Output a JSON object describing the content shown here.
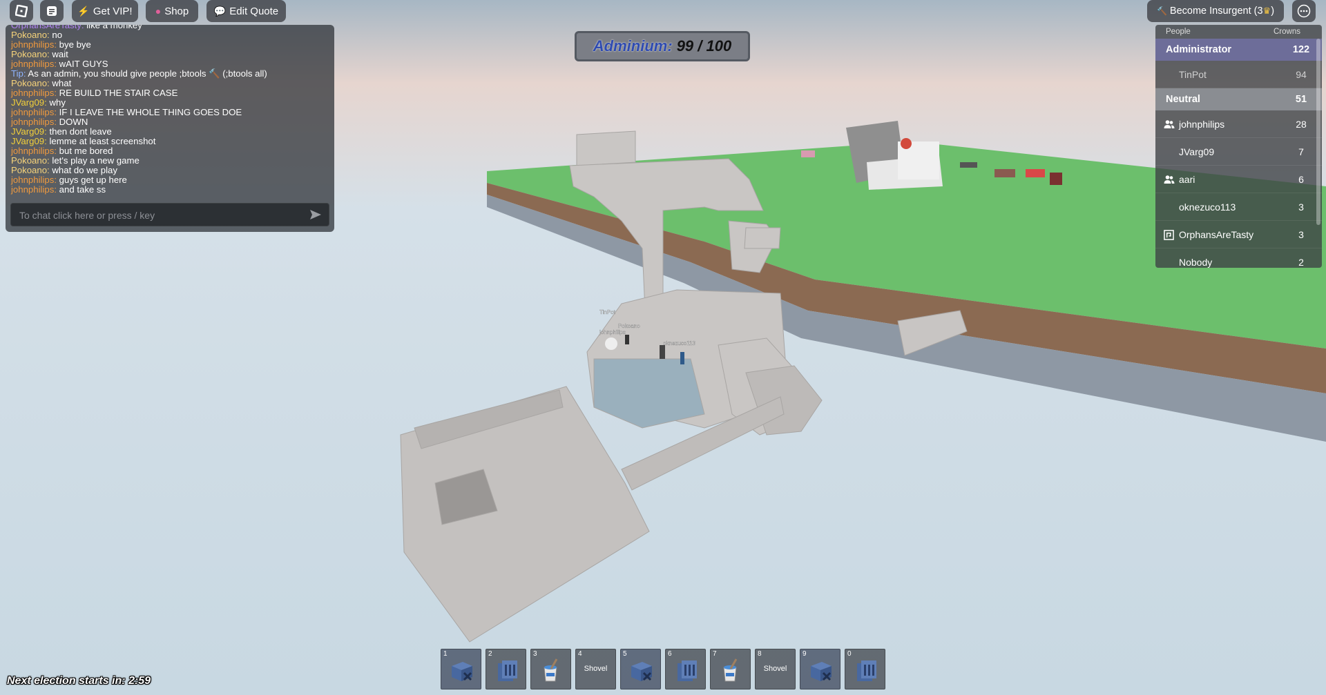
{
  "top_bar": {
    "roblox_icon": "roblox-logo-icon",
    "chat_icon": "chat-icon",
    "vip_label": "Get VIP!",
    "shop_label": "Shop",
    "quote_label": "Edit Quote",
    "insurgent_label": "Become Insurgent (3",
    "insurgent_suffix": ")",
    "menu_icon": "more-menu-icon"
  },
  "chat": {
    "messages": [
      {
        "user": "OrphansAreTasty:",
        "text": " like a monkey",
        "color": "#b183f2"
      },
      {
        "user": "Pokoano:",
        "text": " no",
        "color": "#f6d37a"
      },
      {
        "user": "johnphilips:",
        "text": " bye bye",
        "color": "#f09a3e"
      },
      {
        "user": "Pokoano:",
        "text": " wait",
        "color": "#f6d37a"
      },
      {
        "user": "johnphilips:",
        "text": " wAIT GUYS",
        "color": "#f09a3e"
      },
      {
        "user": "Tip:",
        "text": " As an admin, you should give people ;btools 🔨 (;btools all)",
        "color": "#8fb4ff"
      },
      {
        "user": "Pokoano:",
        "text": " what",
        "color": "#f6d37a"
      },
      {
        "user": "johnphilips:",
        "text": " RE BUILD THE STAIR CASE",
        "color": "#f09a3e"
      },
      {
        "user": "JVarg09:",
        "text": " why",
        "color": "#f2cf3a"
      },
      {
        "user": "johnphilips:",
        "text": " IF I LEAVE THE WHOLE THING GOES DOE",
        "color": "#f09a3e"
      },
      {
        "user": "johnphilips:",
        "text": " DOWN",
        "color": "#f09a3e"
      },
      {
        "user": "JVarg09:",
        "text": " then dont leave",
        "color": "#f2cf3a"
      },
      {
        "user": "JVarg09:",
        "text": " lemme at least screenshot",
        "color": "#f2cf3a"
      },
      {
        "user": "johnphilips:",
        "text": " but me bored",
        "color": "#f09a3e"
      },
      {
        "user": "Pokoano:",
        "text": " let's play a new game",
        "color": "#f6d37a"
      },
      {
        "user": "Pokoano:",
        "text": " what do we play",
        "color": "#f6d37a"
      },
      {
        "user": "johnphilips:",
        "text": " guys get up here",
        "color": "#f09a3e"
      },
      {
        "user": "johnphilips:",
        "text": " and take ss",
        "color": "#f09a3e"
      }
    ],
    "input_placeholder": "To chat click here or press / key",
    "send_icon": "send-arrow-icon"
  },
  "adminium": {
    "label": "Adminium:",
    "value": "99 / 100"
  },
  "leaderboard": {
    "header_people": "People",
    "header_crowns": "Crowns",
    "teams": [
      {
        "name": "Administrator",
        "score": "122",
        "color": "#6d6d99",
        "players": [
          {
            "name": "TinPot",
            "score": "94",
            "icon": "none",
            "dim": true
          }
        ]
      },
      {
        "name": "Neutral",
        "score": "51",
        "color": "#8a8d92",
        "players": [
          {
            "name": "johnphilips",
            "score": "28",
            "icon": "friends-icon",
            "dim": false
          },
          {
            "name": "JVarg09",
            "score": "7",
            "icon": "none",
            "dim": false
          },
          {
            "name": "aari",
            "score": "6",
            "icon": "friends-icon",
            "dim": false
          },
          {
            "name": "oknezuco113",
            "score": "3",
            "icon": "none",
            "dim": false
          },
          {
            "name": "OrphansAreTasty",
            "score": "3",
            "icon": "premium-icon",
            "dim": false
          },
          {
            "name": "Nobody",
            "score": "2",
            "icon": "none",
            "dim": false
          }
        ]
      }
    ]
  },
  "hotbar": {
    "slots": [
      {
        "num": "1",
        "label": "",
        "icon": "build-tools-icon",
        "active": true
      },
      {
        "num": "2",
        "label": "",
        "icon": "delete-tool-icon",
        "active": false
      },
      {
        "num": "3",
        "label": "",
        "icon": "paint-bucket-icon",
        "active": false
      },
      {
        "num": "4",
        "label": "Shovel",
        "icon": "none",
        "active": false
      },
      {
        "num": "5",
        "label": "",
        "icon": "build-tools-icon",
        "active": true
      },
      {
        "num": "6",
        "label": "",
        "icon": "delete-tool-icon",
        "active": false
      },
      {
        "num": "7",
        "label": "",
        "icon": "paint-bucket-icon",
        "active": false
      },
      {
        "num": "8",
        "label": "Shovel",
        "icon": "none",
        "active": false
      },
      {
        "num": "9",
        "label": "",
        "icon": "build-tools-icon",
        "active": true
      },
      {
        "num": "0",
        "label": "",
        "icon": "delete-tool-icon",
        "active": false
      }
    ]
  },
  "election": {
    "label": "Next election starts in:",
    "time": "2:59"
  },
  "world": {
    "player_tags": [
      "TinPot",
      "Pokoano",
      "johnphilips",
      "oknezuco113"
    ]
  }
}
